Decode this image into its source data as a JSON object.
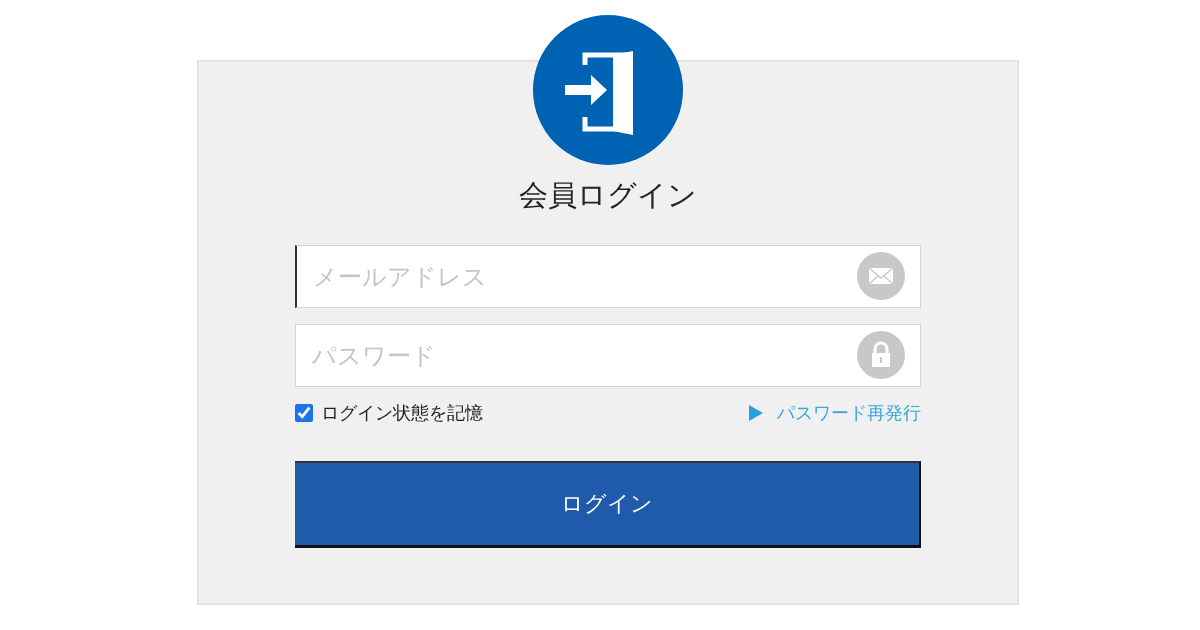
{
  "title": "会員ログイン",
  "email_field": {
    "placeholder": "メールアドレス"
  },
  "password_field": {
    "placeholder": "パスワード"
  },
  "remember": {
    "label": "ログイン状態を記憶",
    "checked": true
  },
  "reset_link": {
    "label": "パスワード再発行"
  },
  "login_button": {
    "label": "ログイン"
  }
}
